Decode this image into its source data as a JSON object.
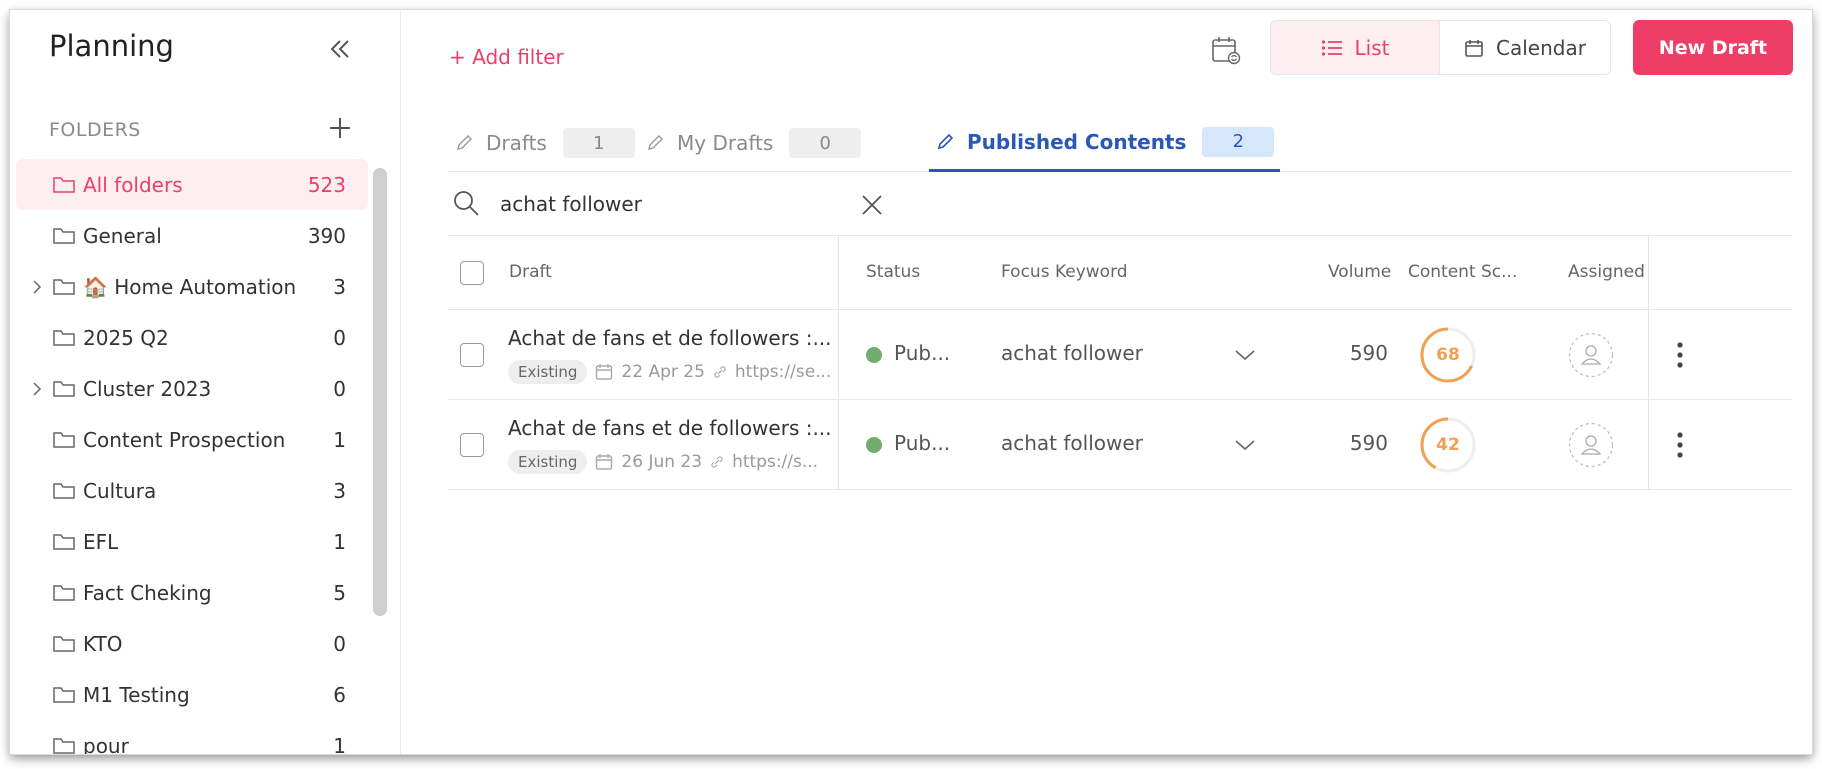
{
  "sidebar": {
    "title": "Planning",
    "folders_label": "FOLDERS",
    "folders": [
      {
        "name": "All folders",
        "count": "523",
        "active": true,
        "expandable": false
      },
      {
        "name": "General",
        "count": "390",
        "active": false,
        "expandable": false
      },
      {
        "name": "🏠 Home Automation",
        "count": "3",
        "active": false,
        "expandable": true
      },
      {
        "name": "2025 Q2",
        "count": "0",
        "active": false,
        "expandable": false
      },
      {
        "name": "Cluster 2023",
        "count": "0",
        "active": false,
        "expandable": true
      },
      {
        "name": "Content Prospection",
        "count": "1",
        "active": false,
        "expandable": false
      },
      {
        "name": "Cultura",
        "count": "3",
        "active": false,
        "expandable": false
      },
      {
        "name": "EFL",
        "count": "1",
        "active": false,
        "expandable": false
      },
      {
        "name": "Fact Cheking",
        "count": "5",
        "active": false,
        "expandable": false
      },
      {
        "name": "KTO",
        "count": "0",
        "active": false,
        "expandable": false
      },
      {
        "name": "M1 Testing",
        "count": "6",
        "active": false,
        "expandable": false
      },
      {
        "name": "pour",
        "count": "1",
        "active": false,
        "expandable": false
      }
    ]
  },
  "toolbar": {
    "add_filter": "+ Add filter",
    "view_list": "List",
    "view_calendar": "Calendar",
    "new_draft": "New Draft"
  },
  "tabs": [
    {
      "label": "Drafts",
      "count": "1",
      "active": false
    },
    {
      "label": "My Drafts",
      "count": "0",
      "active": false
    },
    {
      "label": "Published Contents",
      "count": "2",
      "active": true
    }
  ],
  "search": {
    "value": "achat follower",
    "placeholder": "Search"
  },
  "table": {
    "headers": {
      "draft": "Draft",
      "status": "Status",
      "keyword": "Focus Keyword",
      "volume": "Volume",
      "score": "Content Sc...",
      "assigned": "Assigned"
    },
    "rows": [
      {
        "title": "Achat de fans et de followers :...",
        "tag": "Existing",
        "date": "22 Apr 25",
        "url": "https://se...",
        "status": "Pub...",
        "keyword": "achat follower",
        "volume": "590",
        "score": "68",
        "score_value": 68
      },
      {
        "title": "Achat de fans et de followers :...",
        "tag": "Existing",
        "date": "26 Jun 23",
        "url": "https://s...",
        "status": "Pub...",
        "keyword": "achat follower",
        "volume": "590",
        "score": "42",
        "score_value": 42
      }
    ]
  },
  "colors": {
    "accent": "#e8416b",
    "primary_blue": "#2b57b5",
    "published_green": "#73ad6d",
    "score_orange": "#f0a050"
  }
}
